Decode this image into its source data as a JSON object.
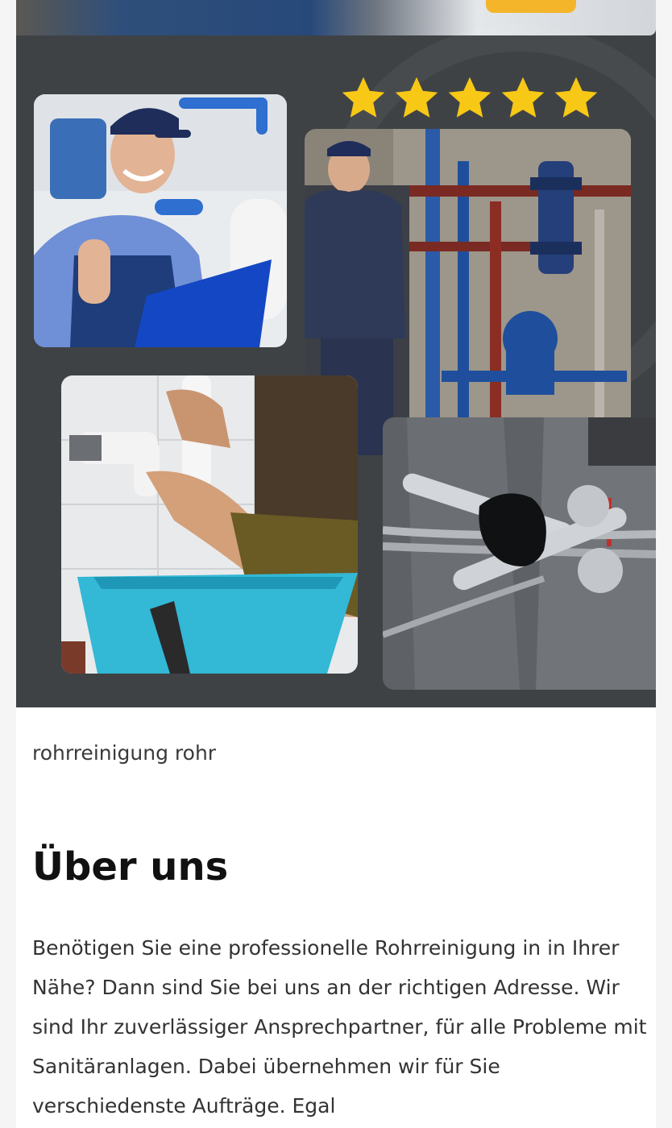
{
  "hero": {
    "rating_stars": 5,
    "star_color": "#F7C815",
    "photos": [
      "Smiling plumber in cap giving thumbs up with blue clipboard",
      "Technician in workwear standing beside blue and red pipe installation",
      "Hands inspecting white drain pipe under sink with blue basin",
      "Gloved hand holding adjustable wrenches and braided hoses"
    ]
  },
  "caption": "rohrreinigung rohr",
  "about": {
    "heading": "Über uns",
    "text": "Benötigen Sie eine professionelle Rohrreinigung in in Ihrer Nähe? Dann sind Sie bei uns an der richtigen Adresse. Wir sind Ihr zuverlässiger Ansprechpartner, für alle Probleme mit Sanitäranlagen. Dabei übernehmen wir für Sie verschiedenste Aufträge. Egal"
  },
  "colors": {
    "hero_background": "#3F4245",
    "accent_yellow": "#F4B52A"
  }
}
